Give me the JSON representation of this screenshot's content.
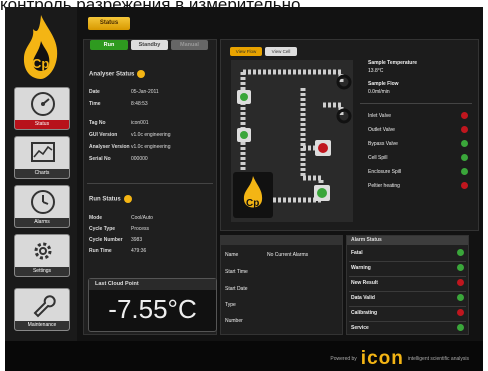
{
  "caption": "контроль разрежения в измерительно",
  "sidebar": {
    "logo_text": "Cp",
    "items": [
      {
        "label": "Status",
        "icon": "gauge-icon"
      },
      {
        "label": "Charts",
        "icon": "chart-icon"
      },
      {
        "label": "Alarms",
        "icon": "clock-icon"
      },
      {
        "label": "Settings",
        "icon": "gear-icon"
      },
      {
        "label": "Maintenance",
        "icon": "wrench-icon"
      }
    ]
  },
  "top": {
    "status_label": "Status"
  },
  "mode_buttons": {
    "run": "Run",
    "standby": "Standby",
    "manual": "Manual"
  },
  "analyser": {
    "title": "Analyser Status",
    "rows": [
      {
        "k": "Date",
        "v": "05-Jan-2011"
      },
      {
        "k": "Time",
        "v": "8:48:53"
      },
      {
        "k": "Tag No",
        "v": "icon001"
      },
      {
        "k": "GUI Version",
        "v": "v1.0c engineering"
      },
      {
        "k": "Analyser Version",
        "v": "v1.0c engineering"
      },
      {
        "k": "Serial No",
        "v": "000000"
      }
    ]
  },
  "run_status": {
    "title": "Run Status",
    "rows": [
      {
        "k": "Mode",
        "v": "Cool/Auto"
      },
      {
        "k": "Cycle Type",
        "v": "Process"
      },
      {
        "k": "Cycle Number",
        "v": "3983"
      },
      {
        "k": "Run Time",
        "v": "479:36"
      }
    ]
  },
  "last_cloud_point": {
    "title": "Last Cloud Point",
    "value": "-7.55°C"
  },
  "view_buttons": {
    "flow": "View Flow",
    "cell": "View Cell"
  },
  "sample": {
    "temp_label": "Sample Temperature",
    "temp_value": "13.8°C",
    "flow_label": "Sample Flow",
    "flow_value": "0.0ml/min"
  },
  "valves": [
    {
      "label": "Inlet Valve",
      "state": "red"
    },
    {
      "label": "Outlet Valve",
      "state": "red"
    },
    {
      "label": "Bypass Valve",
      "state": "green"
    },
    {
      "label": "Cell Spill",
      "state": "green"
    },
    {
      "label": "Enclosure Spill",
      "state": "green"
    },
    {
      "label": "Peltier heating",
      "state": "red"
    }
  ],
  "info_table": {
    "rows": [
      {
        "k": "Name",
        "v": "No Current Alarms"
      },
      {
        "k": "Start Time",
        "v": ""
      },
      {
        "k": "Start Date",
        "v": ""
      },
      {
        "k": "Type",
        "v": ""
      },
      {
        "k": "Number",
        "v": ""
      }
    ]
  },
  "alarm_status": {
    "title": "Alarm Status",
    "rows": [
      {
        "label": "Fatal",
        "state": "green"
      },
      {
        "label": "Warning",
        "state": "green"
      },
      {
        "label": "New Result",
        "state": "red"
      },
      {
        "label": "Data Valid",
        "state": "green"
      },
      {
        "label": "Calibrating",
        "state": "red"
      },
      {
        "label": "Service",
        "state": "green"
      }
    ]
  },
  "footer": {
    "powered_by": "Powered by",
    "brand": "icon",
    "tagline": "intelligent scientific analysis"
  },
  "colors": {
    "accent": "#f4b514",
    "alarm_red": "#c0161e",
    "ok_green": "#3aa63a",
    "run_green": "#2e9a1f"
  }
}
